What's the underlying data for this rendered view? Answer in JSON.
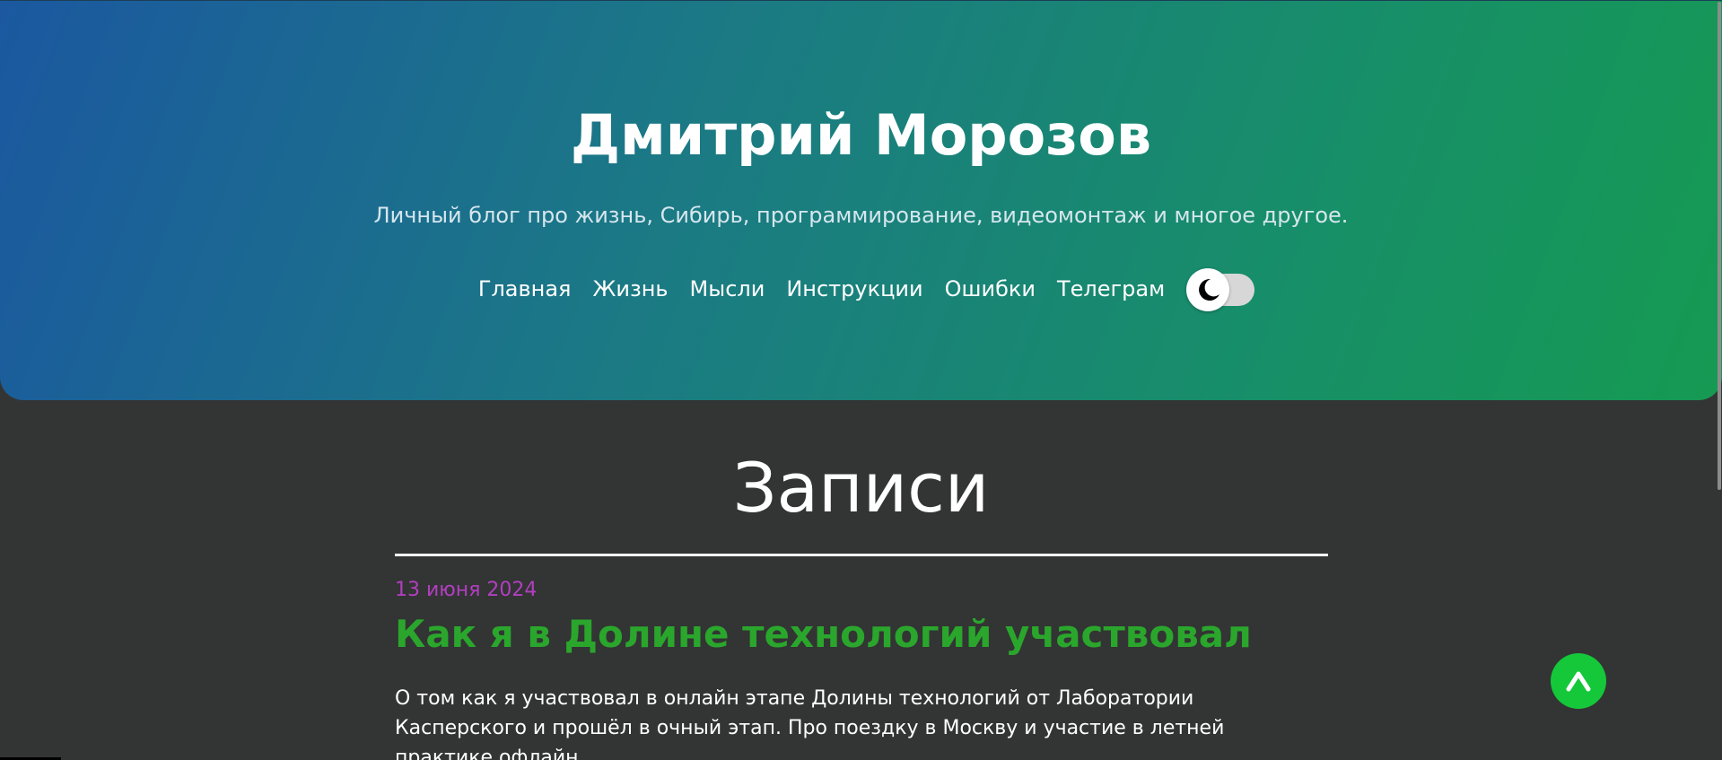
{
  "header": {
    "title": "Дмитрий Морозов",
    "subtitle": "Личный блог про жизнь, Сибирь, программирование, видеомонтаж и многое другое.",
    "nav": [
      {
        "label": "Главная"
      },
      {
        "label": "Жизнь"
      },
      {
        "label": "Мысли"
      },
      {
        "label": "Инструкции"
      },
      {
        "label": "Ошибки"
      },
      {
        "label": "Телеграм"
      }
    ],
    "theme_toggle": {
      "icon": "moon-icon",
      "state": "dark"
    }
  },
  "main": {
    "section_title": "Записи",
    "posts": [
      {
        "date": "13 июня 2024",
        "title": "Как я в Долине технологий участвовал",
        "excerpt": "О том как я участвовал в онлайн этапе Долины технологий от Лаборатории Касперского и прошёл в очный этап. Про поездку в Москву и участие в летней практике офлайн."
      }
    ]
  },
  "scroll_top": {
    "icon": "chevron-up-icon"
  },
  "colors": {
    "header_gradient_start": "#1b58a0",
    "header_gradient_end": "#169a52",
    "background": "#333434",
    "post_date": "#b13fc0",
    "post_title": "#2aa62c",
    "scroll_top_button": "#14c83a"
  }
}
